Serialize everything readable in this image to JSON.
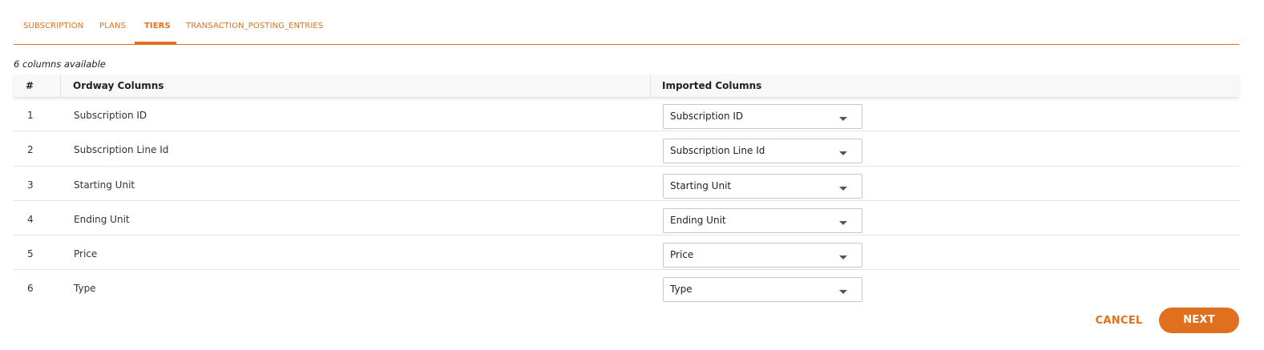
{
  "tabs": [
    {
      "label": "SUBSCRIPTION",
      "active": false
    },
    {
      "label": "PLANS",
      "active": false
    },
    {
      "label": "TIERS",
      "active": true
    },
    {
      "label": "TRANSACTION_POSTING_ENTRIES",
      "active": false
    }
  ],
  "columns_available": "6 columns available",
  "table": {
    "headers": {
      "index": "#",
      "ordway": "Ordway Columns",
      "imported": "Imported Columns"
    },
    "rows": [
      {
        "index": "1",
        "ordway": "Subscription ID",
        "imported": "Subscription ID"
      },
      {
        "index": "2",
        "ordway": "Subscription Line Id",
        "imported": "Subscription Line Id"
      },
      {
        "index": "3",
        "ordway": "Starting Unit",
        "imported": "Starting Unit"
      },
      {
        "index": "4",
        "ordway": "Ending Unit",
        "imported": "Ending Unit"
      },
      {
        "index": "5",
        "ordway": "Price",
        "imported": "Price"
      },
      {
        "index": "6",
        "ordway": "Type",
        "imported": "Type"
      }
    ]
  },
  "actions": {
    "cancel_label": "CANCEL",
    "next_label": "NEXT"
  },
  "colors": {
    "accent": "#e0701e"
  }
}
